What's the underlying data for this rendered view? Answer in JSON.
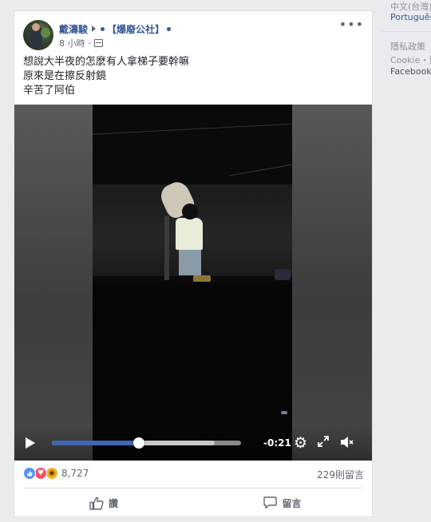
{
  "post": {
    "author": "戴濤駿",
    "group": "【爆廢公社】",
    "time": "8 小時",
    "text_lines": [
      "想說大半夜的怎麼有人拿梯子要幹嘛",
      "原來是在擦反射鏡",
      "辛苦了阿伯"
    ]
  },
  "video": {
    "time_remaining": "-0:21",
    "progress": 0.46,
    "buffered": 0.86
  },
  "stats": {
    "reaction_count": "8,727",
    "comments": "229則留言"
  },
  "actions": {
    "like_label": "讚",
    "comment_label": "留言"
  },
  "sidebar": {
    "languages": [
      "中文(台灣)",
      "Português"
    ],
    "footer": [
      "隱私政策",
      "Cookie・更",
      "Facebook"
    ]
  },
  "colors": {
    "link": "#365899",
    "like_blue": "#5890ff",
    "love_red": "#f25268",
    "wow_yellow": "#f7b125",
    "progress_blue": "#4267b2"
  }
}
